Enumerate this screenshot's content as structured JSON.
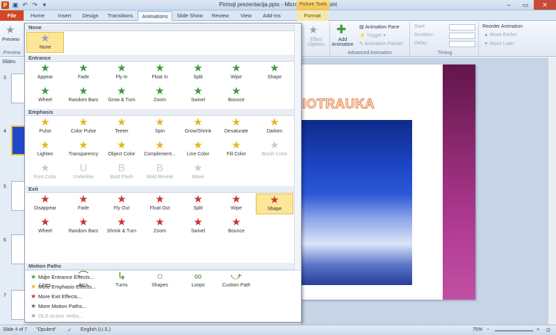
{
  "window": {
    "title": "Pirmoji prezentacija.pptx - Microsoft PowerPoint",
    "context_group": "Picture Tools"
  },
  "tabs": [
    {
      "label": "File",
      "kind": "file"
    },
    {
      "label": "Home",
      "kind": ""
    },
    {
      "label": "Insert",
      "kind": ""
    },
    {
      "label": "Design",
      "kind": ""
    },
    {
      "label": "Transitions",
      "kind": ""
    },
    {
      "label": "Animations",
      "kind": "active"
    },
    {
      "label": "Slide Show",
      "kind": ""
    },
    {
      "label": "Review",
      "kind": ""
    },
    {
      "label": "View",
      "kind": ""
    },
    {
      "label": "Add-Ins",
      "kind": ""
    },
    {
      "label": "Format",
      "kind": "ctx"
    }
  ],
  "ribbon": {
    "preview_label": "Preview",
    "preview_group": "Preview",
    "effect_options": "Effect Options",
    "add_animation": "Add Animation",
    "animation_pane": "Animation Pane",
    "trigger": "Trigger",
    "animation_painter": "Animation Painter",
    "advanced_group": "Advanced Animation",
    "start_label": "Start:",
    "duration_label": "Duration:",
    "delay_label": "Delay:",
    "timing_group": "Timing",
    "reorder_title": "Reorder Animation",
    "move_earlier": "Move Earlier",
    "move_later": "Move Later"
  },
  "slides_panel": {
    "tab_label": "Slides",
    "numbers": [
      "3",
      "4",
      "5",
      "6",
      "7"
    ]
  },
  "gallery": {
    "sections": [
      {
        "title": "None",
        "items": [
          {
            "label": "None",
            "icon": "star",
            "state": "selected"
          }
        ]
      },
      {
        "title": "Entrance",
        "items": [
          {
            "label": "Appear",
            "icon": "star"
          },
          {
            "label": "Fade",
            "icon": "star"
          },
          {
            "label": "Fly In",
            "icon": "star"
          },
          {
            "label": "Float In",
            "icon": "star"
          },
          {
            "label": "Split",
            "icon": "star"
          },
          {
            "label": "Wipe",
            "icon": "star"
          },
          {
            "label": "Shape",
            "icon": "star"
          },
          {
            "label": "Wheel",
            "icon": "star"
          },
          {
            "label": "Random Bars",
            "icon": "star"
          },
          {
            "label": "Grow & Turn",
            "icon": "star"
          },
          {
            "label": "Zoom",
            "icon": "star"
          },
          {
            "label": "Swivel",
            "icon": "star"
          },
          {
            "label": "Bounce",
            "icon": "star"
          }
        ]
      },
      {
        "title": "Emphasis",
        "items": [
          {
            "label": "Pulse",
            "icon": "star"
          },
          {
            "label": "Color Pulse",
            "icon": "star"
          },
          {
            "label": "Teeter",
            "icon": "star"
          },
          {
            "label": "Spin",
            "icon": "star"
          },
          {
            "label": "Grow/Shrink",
            "icon": "star"
          },
          {
            "label": "Desaturate",
            "icon": "star"
          },
          {
            "label": "Darken",
            "icon": "star"
          },
          {
            "label": "Lighten",
            "icon": "star"
          },
          {
            "label": "Transparency",
            "icon": "star"
          },
          {
            "label": "Object Color",
            "icon": "star"
          },
          {
            "label": "Complement...",
            "icon": "star"
          },
          {
            "label": "Line Color",
            "icon": "star"
          },
          {
            "label": "Fill Color",
            "icon": "star"
          },
          {
            "label": "Brush Color",
            "icon": "star",
            "state": "disabled"
          },
          {
            "label": "Font Color",
            "icon": "star",
            "state": "disabled"
          },
          {
            "label": "Underline",
            "icon": "U",
            "state": "disabled"
          },
          {
            "label": "Bold Flash",
            "icon": "B",
            "state": "disabled"
          },
          {
            "label": "Bold Reveal",
            "icon": "B",
            "state": "disabled"
          },
          {
            "label": "Wave",
            "icon": "star",
            "state": "disabled"
          }
        ]
      },
      {
        "title": "Exit",
        "items": [
          {
            "label": "Disappear",
            "icon": "star"
          },
          {
            "label": "Fade",
            "icon": "star"
          },
          {
            "label": "Fly Out",
            "icon": "star"
          },
          {
            "label": "Float Out",
            "icon": "star"
          },
          {
            "label": "Split",
            "icon": "star"
          },
          {
            "label": "Wipe",
            "icon": "star"
          },
          {
            "label": "Shape",
            "icon": "star",
            "state": "selected"
          },
          {
            "label": "Wheel",
            "icon": "star"
          },
          {
            "label": "Random Bars",
            "icon": "star"
          },
          {
            "label": "Shrink & Turn",
            "icon": "star"
          },
          {
            "label": "Zoom",
            "icon": "star"
          },
          {
            "label": "Swivel",
            "icon": "star"
          },
          {
            "label": "Bounce",
            "icon": "star"
          }
        ]
      },
      {
        "title": "Motion Paths",
        "items": [
          {
            "label": "Lines",
            "icon": "line"
          },
          {
            "label": "Arcs",
            "icon": "arc"
          },
          {
            "label": "Turns",
            "icon": "turn"
          },
          {
            "label": "Shapes",
            "icon": "circle"
          },
          {
            "label": "Loops",
            "icon": "loop"
          },
          {
            "label": "Custom Path",
            "icon": "custom"
          }
        ]
      }
    ],
    "menu": [
      {
        "label": "More Entrance Effects...",
        "color": "#3c9a35"
      },
      {
        "label": "More Emphasis Effects...",
        "color": "#e6b420"
      },
      {
        "label": "More Exit Effects...",
        "color": "#cc3333"
      },
      {
        "label": "More Motion Paths...",
        "color": "#666666"
      },
      {
        "label": "OLE Action Verbs...",
        "color": "#a2a9b3",
        "state": "disabled"
      }
    ]
  },
  "slide": {
    "title_fragment": "IOTRAUKA"
  },
  "status": {
    "slide_info": "Slide 4 of 7",
    "theme": "\"Opulent\"",
    "language": "English (U.S.)",
    "zoom": "75%"
  },
  "colors": {
    "entrance": "#3c9a35",
    "emphasis": "#e6b420",
    "exit": "#cc3333",
    "motion": "#4d8b2f",
    "selection": "#fbe699"
  }
}
